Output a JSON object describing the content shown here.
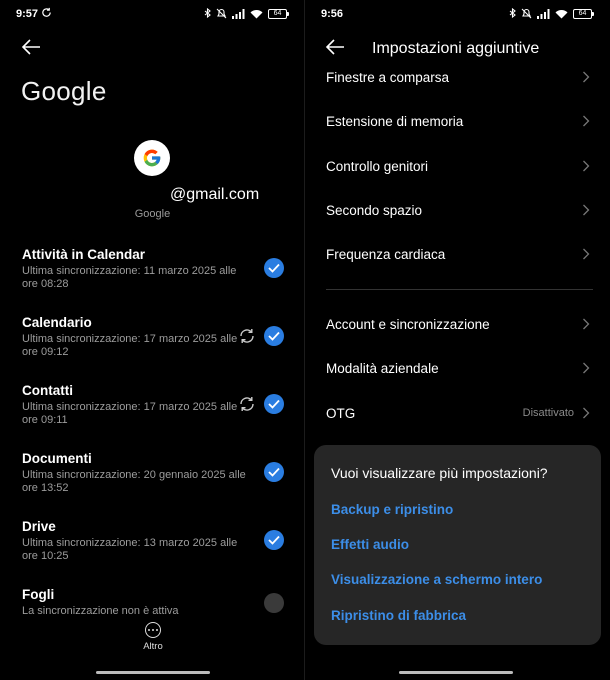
{
  "left_screen": {
    "status": {
      "time": "9:57",
      "battery": "64"
    },
    "title": "Google",
    "account": {
      "email": "@gmail.com",
      "provider": "Google"
    },
    "sync_items": [
      {
        "title": "Attività in Calendar",
        "subtitle": "Ultima sincronizzazione: 11 marzo 2025 alle ore 08:28",
        "checked": true,
        "syncing": false
      },
      {
        "title": "Calendario",
        "subtitle": "Ultima sincronizzazione: 17 marzo 2025 alle ore 09:12",
        "checked": true,
        "syncing": true
      },
      {
        "title": "Contatti",
        "subtitle": "Ultima sincronizzazione: 17 marzo 2025 alle ore 09:11",
        "checked": true,
        "syncing": true
      },
      {
        "title": "Documenti",
        "subtitle": "Ultima sincronizzazione: 20 gennaio 2025 alle ore 13:52",
        "checked": true,
        "syncing": false
      },
      {
        "title": "Drive",
        "subtitle": "Ultima sincronizzazione: 13 marzo 2025 alle ore 10:25",
        "checked": true,
        "syncing": false
      },
      {
        "title": "Fogli",
        "subtitle": "La sincronizzazione non è attiva",
        "checked": false,
        "syncing": false
      }
    ],
    "more_label": "Altro"
  },
  "right_screen": {
    "status": {
      "time": "9:56",
      "battery": "64"
    },
    "title": "Impostazioni aggiuntive",
    "settings": [
      {
        "label": "Finestre a comparsa",
        "value": ""
      },
      {
        "label": "Estensione di memoria",
        "value": ""
      },
      {
        "label": "Controllo genitori",
        "value": ""
      },
      {
        "label": "Secondo spazio",
        "value": ""
      },
      {
        "label": "Frequenza cardiaca",
        "value": ""
      },
      {
        "label": "Account e sincronizzazione",
        "value": ""
      },
      {
        "label": "Modalità aziendale",
        "value": ""
      },
      {
        "label": "OTG",
        "value": "Disattivato"
      }
    ],
    "popup": {
      "title": "Vuoi visualizzare più impostazioni?",
      "links": [
        "Backup e ripristino",
        "Effetti audio",
        "Visualizzazione a schermo intero",
        "Ripristino di fabbrica"
      ]
    }
  },
  "colors": {
    "accent": "#2a7de1",
    "link": "#3c8ee8",
    "popup_bg": "#262626"
  }
}
